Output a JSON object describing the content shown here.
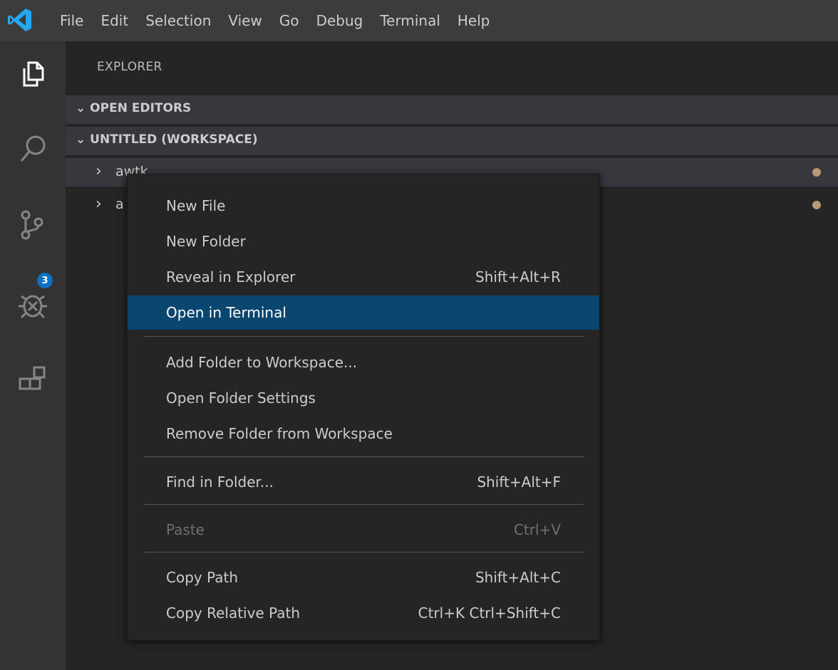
{
  "menubar": {
    "logo_icon": "vscode-logo-icon",
    "items": [
      "File",
      "Edit",
      "Selection",
      "View",
      "Go",
      "Debug",
      "Terminal",
      "Help"
    ]
  },
  "activitybar": {
    "icons": [
      "explorer-icon",
      "search-icon",
      "source-control-icon",
      "debug-icon",
      "extensions-icon"
    ],
    "source_control_badge": "3"
  },
  "sidebar": {
    "title": "EXPLORER",
    "sections": {
      "open_editors": "OPEN EDITORS",
      "workspace": "UNTITLED (WORKSPACE)"
    },
    "tree": [
      {
        "label": "awtk",
        "dot_color": "#b89a78"
      },
      {
        "label": "a",
        "dot_color": "#b89a78"
      }
    ]
  },
  "context_menu": {
    "items": [
      {
        "label": "New File",
        "key": ""
      },
      {
        "label": "New Folder",
        "key": ""
      },
      {
        "label": "Reveal in Explorer",
        "key": "Shift+Alt+R"
      },
      {
        "label": "Open in Terminal",
        "key": "",
        "highlighted": true
      },
      {
        "label": "Add Folder to Workspace...",
        "key": ""
      },
      {
        "label": "Open Folder Settings",
        "key": ""
      },
      {
        "label": "Remove Folder from Workspace",
        "key": ""
      },
      {
        "label": "Find in Folder...",
        "key": "Shift+Alt+F"
      },
      {
        "label": "Paste",
        "key": "Ctrl+V",
        "disabled": true
      },
      {
        "label": "Copy Path",
        "key": "Shift+Alt+C"
      },
      {
        "label": "Copy Relative Path",
        "key": "Ctrl+K Ctrl+Shift+C"
      }
    ]
  },
  "colors": {
    "highlight": "#094771",
    "badge": "#0e70c0",
    "logo": "#23a9f2"
  }
}
